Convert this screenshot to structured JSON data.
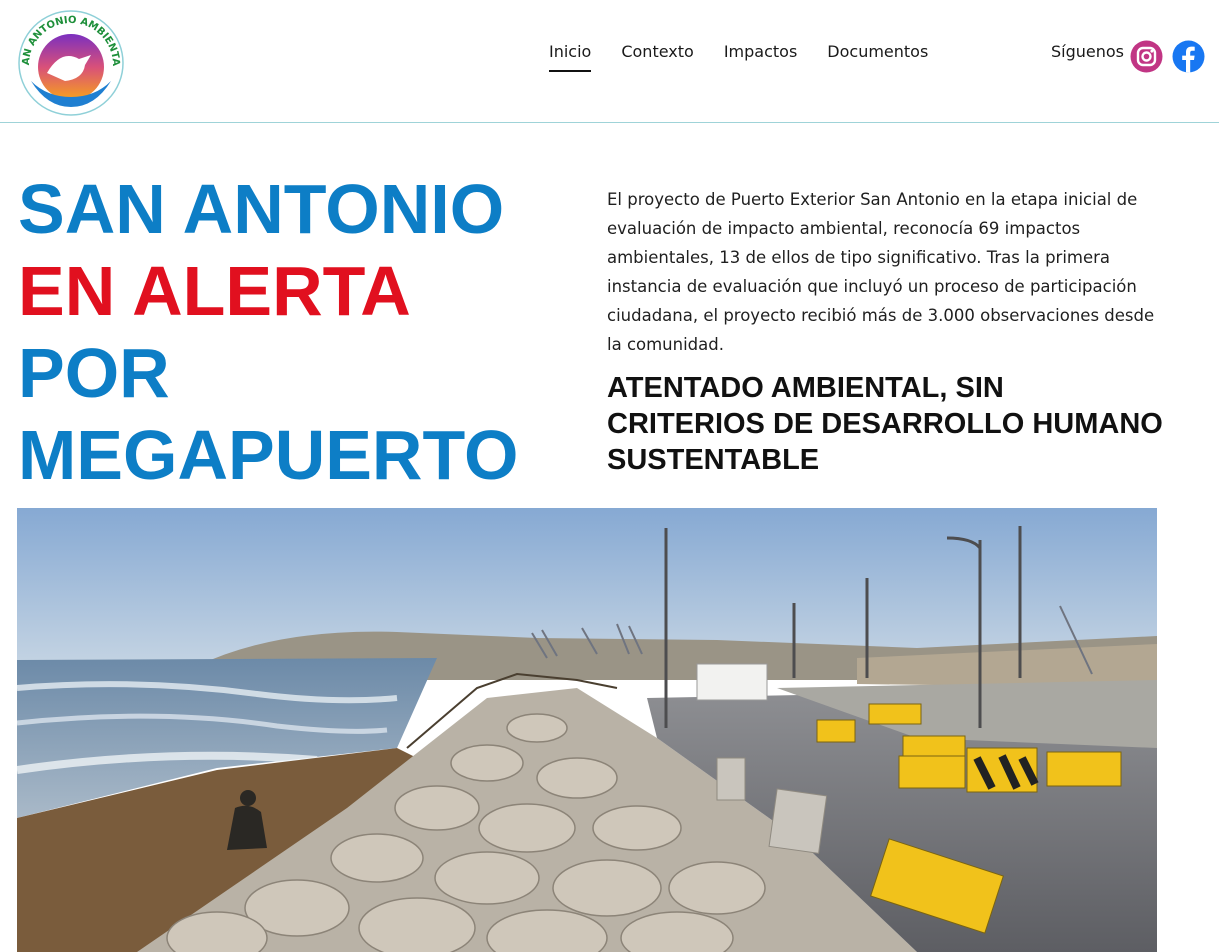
{
  "site": {
    "logo_text": "SAN ANTONIO AMBIENTAL"
  },
  "nav": {
    "items": [
      {
        "label": "Inicio",
        "active": true
      },
      {
        "label": "Contexto",
        "active": false
      },
      {
        "label": "Impactos",
        "active": false
      },
      {
        "label": "Documentos",
        "active": false
      }
    ]
  },
  "social": {
    "label": "Síguenos",
    "icons": [
      "instagram-icon",
      "facebook-icon"
    ],
    "colors": {
      "instagram": "#c13584",
      "facebook": "#1877f2"
    }
  },
  "hero": {
    "title_lines": [
      {
        "text": "SAN ANTONIO",
        "color": "#0d7ec6"
      },
      {
        "text": "EN ALERTA",
        "color": "#e1101f"
      },
      {
        "text": "POR",
        "color": "#0d7ec6"
      },
      {
        "text": "MEGAPUERTO",
        "color": "#0d7ec6"
      }
    ],
    "intro": "El proyecto de Puerto Exterior San Antonio en la etapa inicial de evaluación de impacto ambiental, reconocía 69 impactos ambientales, 13 de ellos de tipo significativo.  Tras la primera instancia de evaluación que incluyó un proceso de participación ciudadana, el proyecto recibió más de 3.000  observaciones desde la comunidad.",
    "subhead": "ATENTADO AMBIENTAL, SIN CRITERIOS DE DESARROLLO HUMANO SUSTENTABLE"
  }
}
